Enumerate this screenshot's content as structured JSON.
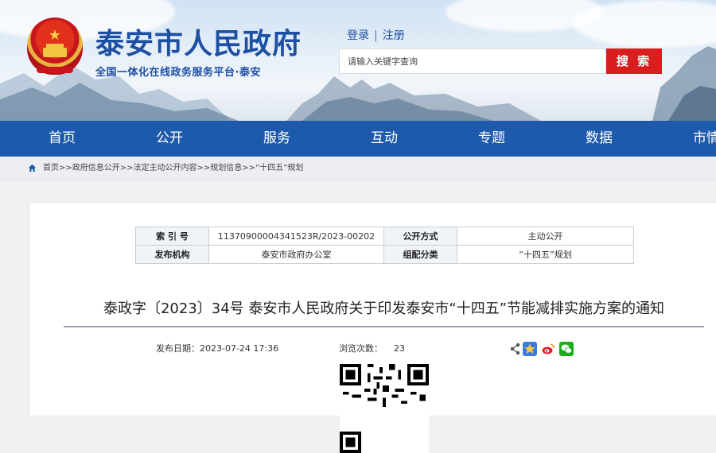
{
  "header": {
    "site_title": "泰安市人民政府",
    "slogan": "全国一体化在线政务服务平台·泰安",
    "login_label": "登录",
    "separator": "|",
    "register_label": "注册",
    "search_placeholder": "请输入关键字查询",
    "search_button": "搜 索"
  },
  "nav": {
    "items": [
      "首页",
      "公开",
      "服务",
      "互动",
      "专题",
      "数据",
      "市情"
    ]
  },
  "breadcrumb": {
    "items": [
      "首页",
      "政府信息公开",
      "法定主动公开内容",
      "规划信息",
      "“十四五”规划"
    ],
    "separator": ">>"
  },
  "meta_table": {
    "index_label": "索 引 号",
    "index_value": "11370900004341523R/2023-00202",
    "open_mode_label": "公开方式",
    "open_mode_value": "主动公开",
    "issuer_label": "发布机构",
    "issuer_value": "泰安市政府办公室",
    "category_label": "组配分类",
    "category_value": "“十四五”规划"
  },
  "article": {
    "title": "泰政字〔2023〕34号 泰安市人民政府关于印发泰安市“十四五”节能减排实施方案的通知",
    "pubdate_label": "发布日期：",
    "pubdate_value": "2023-07-24 17:36",
    "views_label": "浏览次数：",
    "views_value": "23"
  },
  "share_icons": [
    "share-icon",
    "qzone-icon",
    "weibo-icon",
    "wechat-icon"
  ],
  "colors": {
    "brand_blue": "#1e5aab",
    "search_red": "#d81e1e",
    "title_blue": "#1d4fa3"
  }
}
